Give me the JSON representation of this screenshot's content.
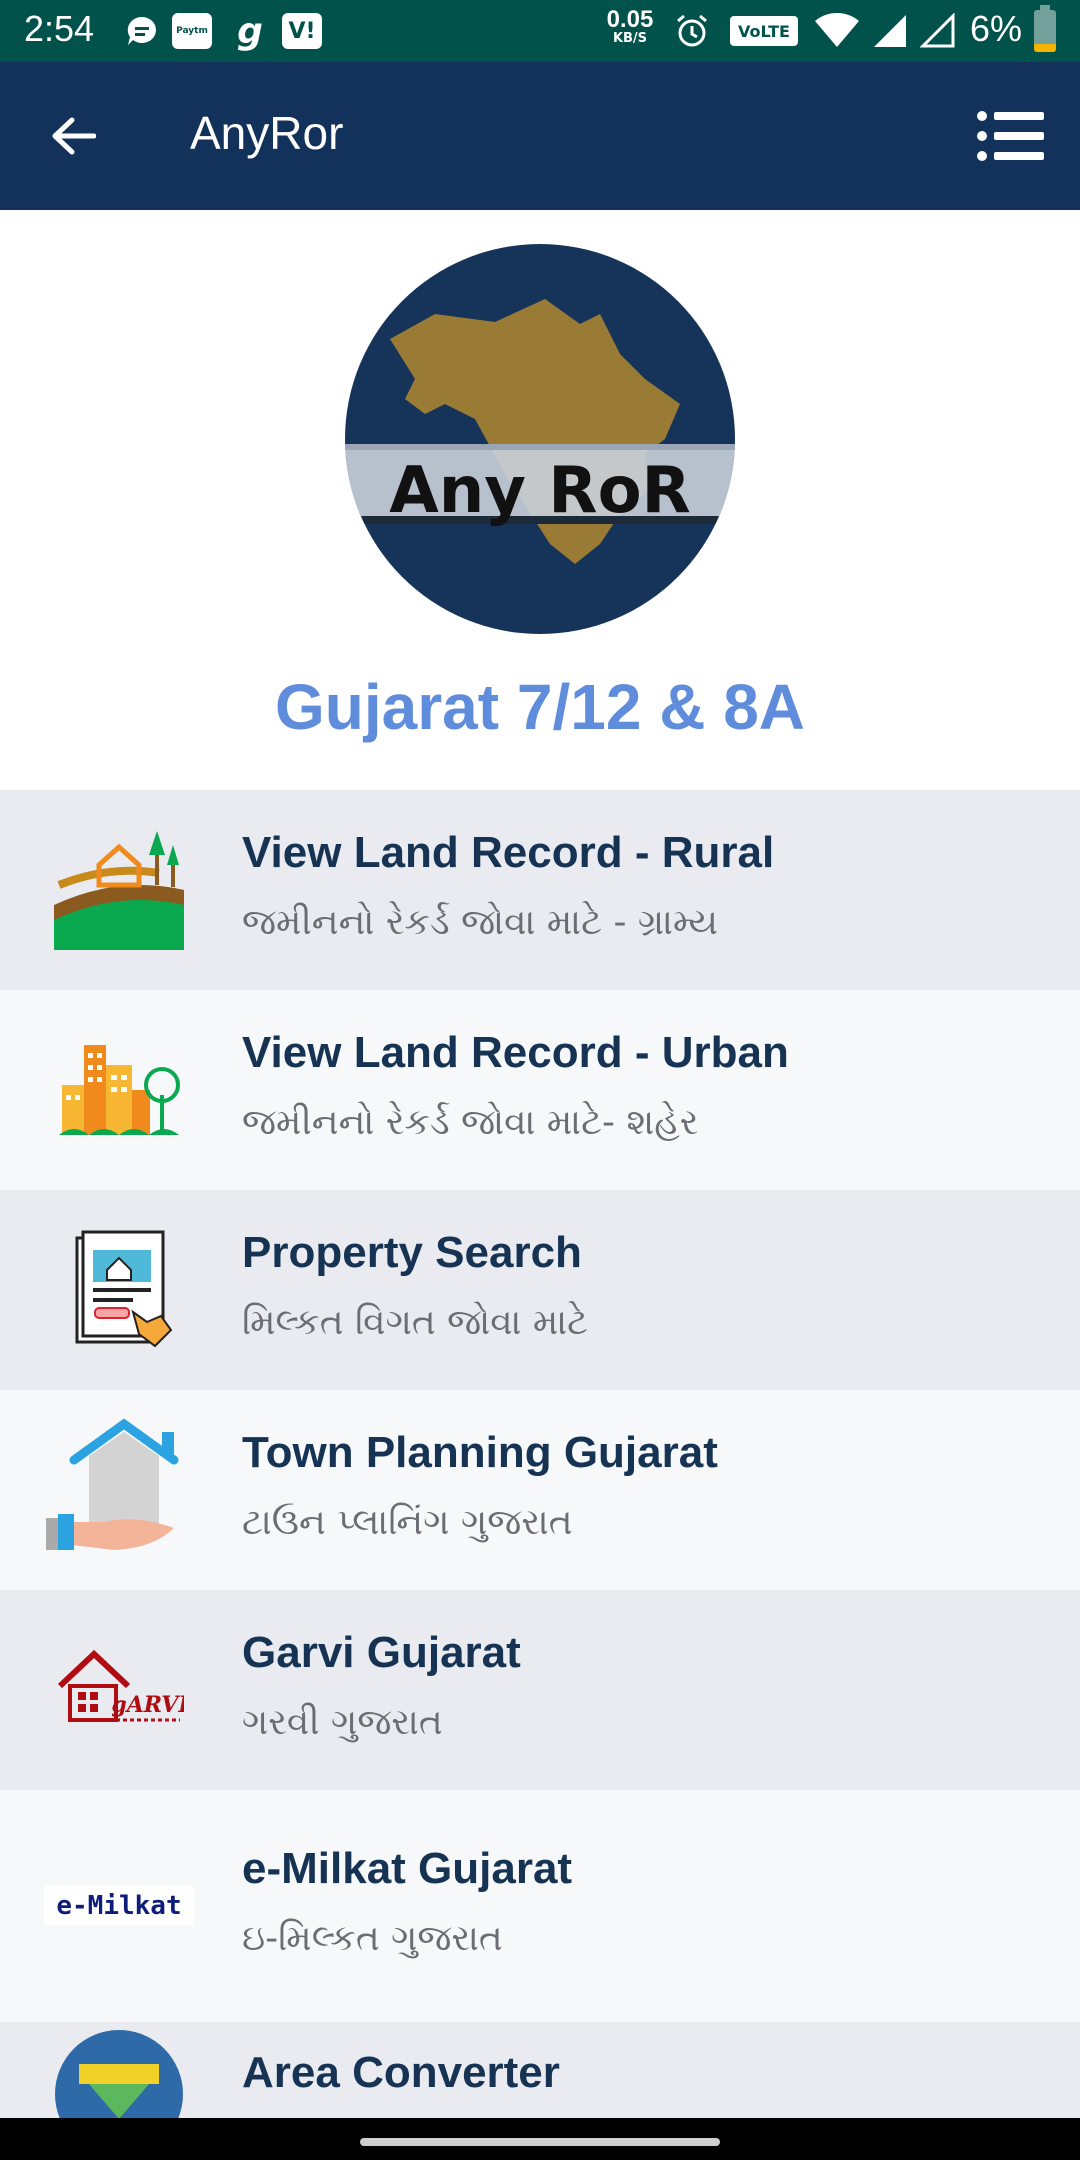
{
  "status_bar": {
    "time": "2:54",
    "net_speed_value": "0.05",
    "net_speed_unit": "KB/S",
    "volte": "VoLTE",
    "battery": "6%",
    "notif_g": "g",
    "notif_vi": "V!"
  },
  "app_bar": {
    "title": "AnyRor"
  },
  "logo": {
    "text": "Any RoR"
  },
  "brand_title": "Gujarat 7/12 & 8A",
  "items": [
    {
      "title": "View Land Record - Rural",
      "subtitle": "જમીનનો રેકર્ડ જોવા માટે - ગ્રામ્ય"
    },
    {
      "title": "View Land Record - Urban",
      "subtitle": "જમીનનો રેકર્ડ જોવા માટે- શહેર"
    },
    {
      "title": "Property Search",
      "subtitle": "મિલ્કત વિગત જોવા માટે"
    },
    {
      "title": "Town Planning Gujarat",
      "subtitle": "ટાઉન પ્લાનિંગ ગુજરાત"
    },
    {
      "title": "Garvi Gujarat",
      "subtitle": "ગરવી ગુજરાત",
      "icon_text": "gARVI"
    },
    {
      "title": "e-Milkat Gujarat",
      "subtitle": "ઇ-મિલ્કત ગુજરાત",
      "icon_text": "e-Milkat"
    },
    {
      "title": "Area Converter",
      "subtitle": ""
    }
  ],
  "colors": {
    "status_bar": "#00524a",
    "app_bar": "#13325b",
    "brand_title": "#5f8ddc",
    "item_title": "#163354"
  }
}
